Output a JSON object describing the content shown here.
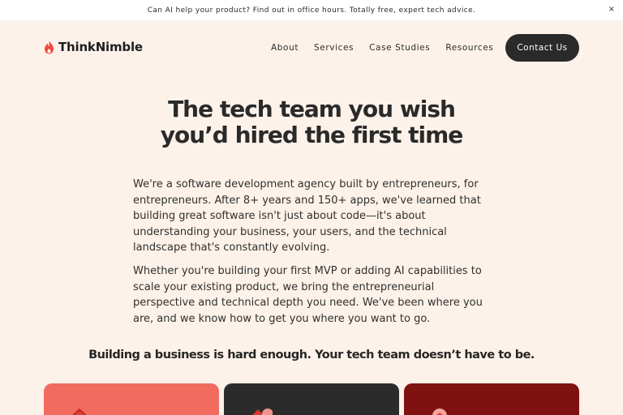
{
  "banner": {
    "text": "Can AI help your product? Find out in office hours. Totally free, expert tech advice.",
    "close_icon": "close-icon",
    "close_glyph": "×"
  },
  "nav": {
    "logo_icon": "flame-icon",
    "logo_text": "ThinkNimble",
    "links": [
      "About",
      "Services",
      "Case Studies",
      "Resources"
    ],
    "cta_label": "Contact Us"
  },
  "hero": {
    "title_line1": "The tech team you wish",
    "title_line2": "you’d hired the first time",
    "paragraph1": "We're a software development agency built by entrepreneurs, for entrepreneurs. After 8+ years and 150+ apps, we've learned that building great software isn't just about code—it's about understanding your business, your users, and the technical landscape that's constantly evolving.",
    "paragraph2": "Whether you're building your first MVP or adding AI capabilities to scale your existing product, we bring the entrepreneurial perspective and technical depth you need. We've been where you are, and we know how to get you where you want to go.",
    "tagline": "Building a business is hard enough. Your tech team doesn’t have to be."
  },
  "cards": [
    {
      "icon": "card-illustration-icon"
    },
    {
      "icon": "card-illustration-icon"
    },
    {
      "icon": "card-illustration-icon"
    }
  ],
  "colors": {
    "page_background": "#fdf2ea",
    "banner_background": "#ffffff",
    "logo_accent": "#ef4a3d",
    "cta_background": "#2a2a2a",
    "cta_text": "#ffffff",
    "card_1": "#f26b5f",
    "card_2": "#2b2b2b",
    "card_3": "#7f1210"
  }
}
